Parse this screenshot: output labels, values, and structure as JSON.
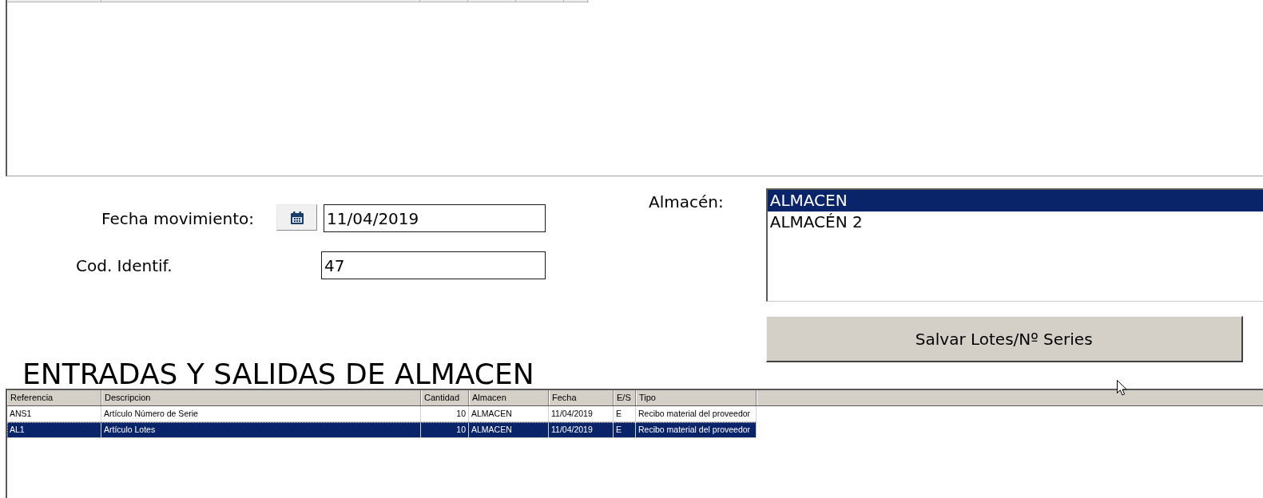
{
  "form": {
    "fields": [
      {
        "kind": "date",
        "label": "Fecha movimiento:",
        "value": "11/04/2019"
      },
      {
        "kind": "text",
        "label": "Cod. Identif.",
        "value": "47"
      }
    ]
  },
  "almacen": {
    "label": "Almacén:",
    "options": [
      {
        "label": "ALMACEN",
        "selected": true
      },
      {
        "label": "ALMACÉN 2",
        "selected": false
      }
    ]
  },
  "save_button": {
    "label": "Salvar Lotes/Nº Series"
  },
  "movements": {
    "title": "ENTRADAS Y SALIDAS DE ALMACEN",
    "columns": [
      "Referencia",
      "Descripcion",
      "Cantidad",
      "Almacen",
      "Fecha",
      "E/S",
      "Tipo"
    ],
    "rows": [
      {
        "selected": false,
        "cells": [
          "ANS1",
          "Artículo Número de Serie",
          "10",
          "ALMACEN",
          "11/04/2019",
          "E",
          "Recibo material del proveedor"
        ]
      },
      {
        "selected": true,
        "cells": [
          "AL1",
          "Artículo Lotes",
          "10",
          "ALMACEN",
          "11/04/2019",
          "E",
          "Recibo material del proveedor"
        ]
      }
    ]
  }
}
